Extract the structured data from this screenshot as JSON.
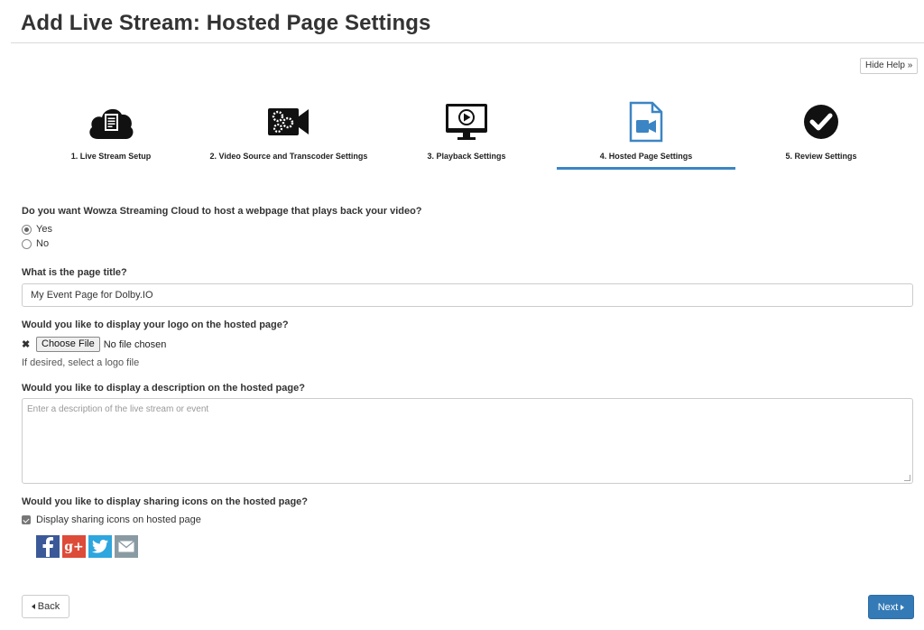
{
  "page": {
    "title": "Add Live Stream: Hosted Page Settings"
  },
  "help_button": {
    "label": "Hide Help »"
  },
  "wizard": {
    "steps": [
      {
        "label": "1. Live Stream Setup",
        "icon": "cloud-document-icon"
      },
      {
        "label": "2. Video Source and Transcoder Settings",
        "icon": "video-camera-gears-icon"
      },
      {
        "label": "3. Playback Settings",
        "icon": "monitor-play-icon"
      },
      {
        "label": "4. Hosted Page Settings",
        "icon": "page-video-icon",
        "active": true
      },
      {
        "label": "5. Review Settings",
        "icon": "check-circle-icon"
      }
    ],
    "active_color": "#3c85c4"
  },
  "host_question": {
    "label": "Do you want Wowza Streaming Cloud to host a webpage that plays back your video?",
    "options": [
      {
        "label": "Yes",
        "selected": true
      },
      {
        "label": "No",
        "selected": false
      }
    ]
  },
  "page_title_field": {
    "label": "What is the page title?",
    "value": "My Event Page for Dolby.IO"
  },
  "logo": {
    "label": "Would you like to display your logo on the hosted page?",
    "button": "Choose File",
    "status": "No file chosen",
    "hint": "If desired, select a logo file"
  },
  "description": {
    "label": "Would you like to display a description on the hosted page?",
    "placeholder": "Enter a description of the live stream or event"
  },
  "sharing": {
    "label": "Would you like to display sharing icons on the hosted page?",
    "checkbox_label": "Display sharing icons on hosted page",
    "checked": true,
    "icons": [
      "facebook-icon",
      "google-plus-icon",
      "twitter-icon",
      "email-icon"
    ],
    "icon_text": {
      "google_plus": "g+"
    },
    "colors": {
      "facebook": "#3b5998",
      "google_plus": "#dd4b39",
      "twitter": "#2ea6de",
      "email": "#8a9aa3"
    }
  },
  "nav": {
    "back": "Back",
    "next": "Next",
    "next_color": "#337ab7"
  }
}
